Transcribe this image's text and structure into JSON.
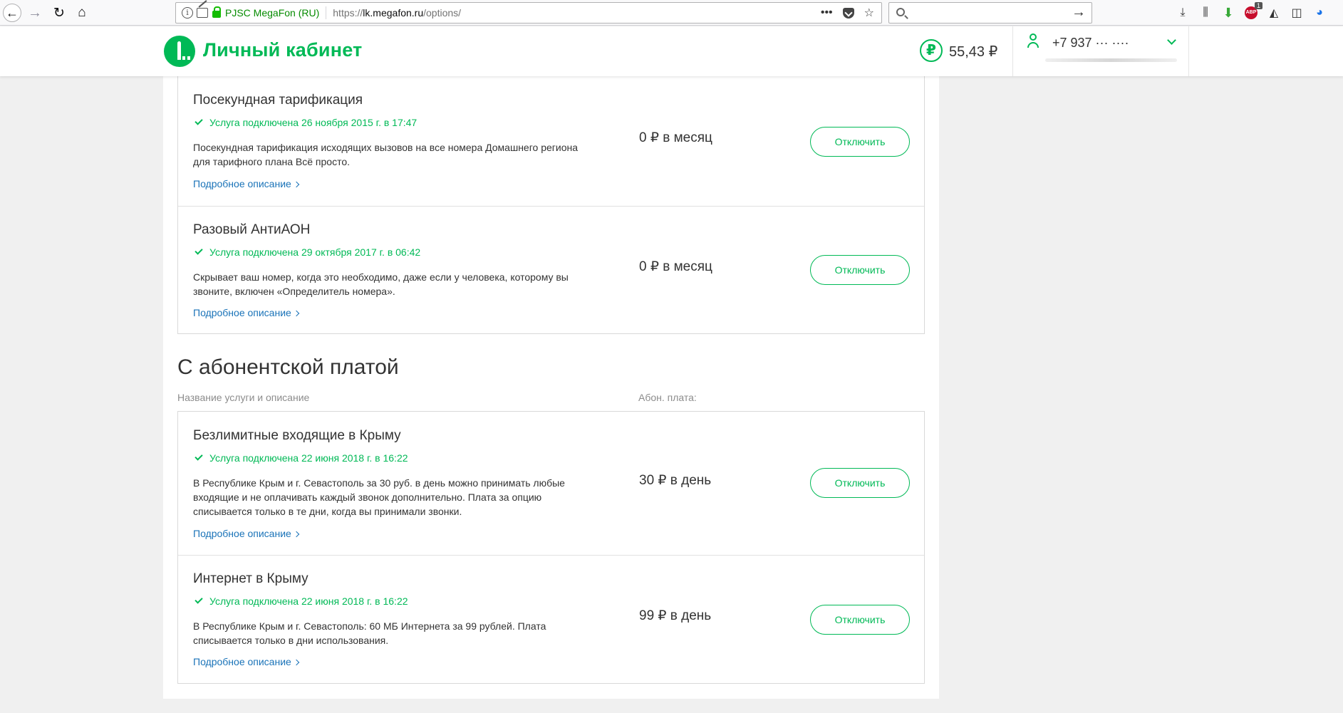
{
  "browser": {
    "site_identity": "PJSC MegaFon (RU)",
    "url_prefix": "https://",
    "url_domain": "lk.megafon.ru",
    "url_path": "/options/",
    "page_actions_glyph": "•••",
    "bookmark_star": "☆",
    "search_go": "→",
    "adblock_text": "ABP",
    "adblock_badge": "1"
  },
  "header": {
    "logo_text": "Личный кабинет",
    "balance_symbol": "₽",
    "balance": "55,43 ₽",
    "phone": "+7 937 ··· ····"
  },
  "services_top": [
    {
      "title": "Посекундная тарификация",
      "status": "Услуга подключена 26 ноября 2015 г. в 17:47",
      "description": "Посекундная тарификация исходящих вызовов на все номера Домашнего региона для тарифного плана Всё просто.",
      "more": "Подробное описание",
      "price": "0 ₽ в месяц",
      "button": "Отключить"
    },
    {
      "title": "Разовый АнтиАОН",
      "status": "Услуга подключена 29 октября 2017 г. в 06:42",
      "description": "Скрывает ваш номер, когда это необходимо, даже если у человека, которому вы звоните, включен «Определитель номера».",
      "more": "Подробное описание",
      "price": "0 ₽ в месяц",
      "button": "Отключить"
    }
  ],
  "section_paid": {
    "title": "С абонентской платой",
    "col_name": "Название услуги и описание",
    "col_fee": "Абон. плата:"
  },
  "services_paid": [
    {
      "title": "Безлимитные входящие в Крыму",
      "status": "Услуга подключена 22 июня 2018 г. в 16:22",
      "description": "В Республике Крым и г. Севастополь за 30 руб. в день можно принимать любые входящие и не оплачивать каждый звонок дополнительно. Плата за опцию списывается только в те дни, когда вы принимали звонки.",
      "more": "Подробное описание",
      "price": "30 ₽ в день",
      "button": "Отключить"
    },
    {
      "title": "Интернет в Крыму",
      "status": "Услуга подключена 22 июня 2018 г. в 16:22",
      "description": "В Республике Крым и г. Севастополь: 60 МБ Интернета за 99 рублей. Плата списывается только в дни использования.",
      "more": "Подробное описание",
      "price": "99 ₽ в день",
      "button": "Отключить"
    }
  ]
}
